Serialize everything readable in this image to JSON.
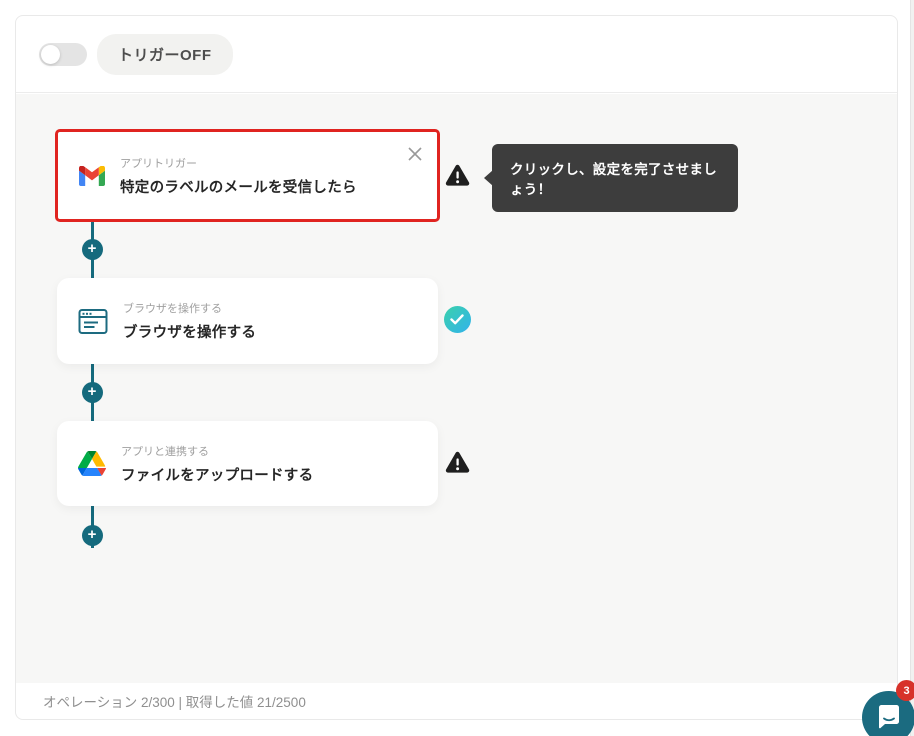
{
  "header": {
    "trigger_toggle": {
      "state": "off",
      "label": "トリガーOFF"
    }
  },
  "workflow": {
    "add_button_label": "+",
    "tooltip": {
      "text": "クリックし、設定を完了させましょう！"
    },
    "nodes": [
      {
        "icon": "gmail-icon",
        "category": "アプリトリガー",
        "title": "特定のラベルのメールを受信したら",
        "status": "warning",
        "selected": true
      },
      {
        "icon": "browser-icon",
        "category": "ブラウザを操作する",
        "title": "ブラウザを操作する",
        "status": "done",
        "selected": false
      },
      {
        "icon": "google-drive-icon",
        "category": "アプリと連携する",
        "title": "ファイルをアップロードする",
        "status": "warning",
        "selected": false
      }
    ]
  },
  "footer": {
    "status_text": "オペレーション 2/300 | 取得した値 21/2500"
  },
  "chat": {
    "badge_count": "3"
  },
  "colors": {
    "accent_teal": "#156a7d",
    "selected_border_red": "#e02420",
    "warning_icon": "#1f1f1f",
    "success_gradient_start": "#3bd1ab",
    "success_gradient_end": "#31b2ec",
    "tooltip_bg": "#3d3d3d",
    "canvas_bg": "#f7f7f6",
    "chat_button_bg": "#1b6b80",
    "chat_badge_bg": "#d7322a"
  }
}
